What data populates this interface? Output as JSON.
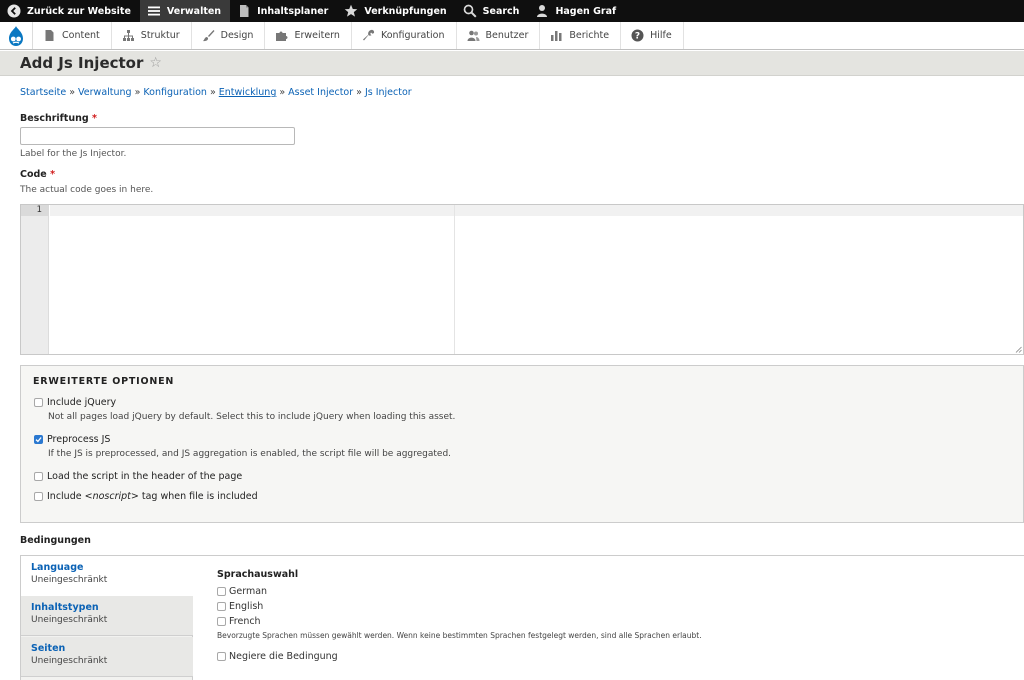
{
  "toolbar": {
    "items": [
      {
        "label": "Zurück zur Website",
        "icon": "arrow-left-circle-icon"
      },
      {
        "label": "Verwalten",
        "icon": "hamburger-menu-icon"
      },
      {
        "label": "Inhaltsplaner",
        "icon": "document-icon"
      },
      {
        "label": "Verknüpfungen",
        "icon": "star-icon"
      },
      {
        "label": "Search",
        "icon": "search-icon"
      },
      {
        "label": "Hagen Graf",
        "icon": "user-icon"
      }
    ]
  },
  "tray": {
    "logo": "drupal-logo-icon",
    "items": [
      {
        "label": "Content",
        "icon": "page-icon"
      },
      {
        "label": "Struktur",
        "icon": "hierarchy-icon"
      },
      {
        "label": "Design",
        "icon": "paintbrush-icon"
      },
      {
        "label": "Erweitern",
        "icon": "puzzle-icon"
      },
      {
        "label": "Konfiguration",
        "icon": "wrench-icon"
      },
      {
        "label": "Benutzer",
        "icon": "people-icon"
      },
      {
        "label": "Berichte",
        "icon": "bar-chart-icon"
      },
      {
        "label": "Hilfe",
        "icon": "help-icon"
      }
    ]
  },
  "page": {
    "title": "Add Js Injector"
  },
  "breadcrumb": [
    "Startseite",
    "Verwaltung",
    "Konfiguration",
    "Entwicklung",
    "Asset Injector",
    "Js Injector"
  ],
  "form": {
    "label_field": {
      "label": "Beschriftung",
      "required_mark": "*",
      "value": "",
      "description": "Label for the Js Injector."
    },
    "code_field": {
      "label": "Code",
      "required_mark": "*",
      "description": "The actual code goes in here.",
      "line_number": "1"
    },
    "advanced": {
      "legend": "ERWEITERTE OPTIONEN",
      "options": [
        {
          "label": "Include jQuery",
          "checked": false,
          "description": "Not all pages load jQuery by default. Select this to include jQuery when loading this asset."
        },
        {
          "label": "Preprocess JS",
          "checked": true,
          "description": "If the JS is preprocessed, and JS aggregation is enabled, the script file will be aggregated."
        },
        {
          "label": "Load the script in the header of the page",
          "checked": false,
          "description": ""
        },
        {
          "label_prefix": "Include ",
          "label_code": "<noscript>",
          "label_suffix": " tag when file is included",
          "checked": false,
          "description": ""
        }
      ]
    },
    "conditions": {
      "heading": "Bedingungen",
      "tabs": [
        {
          "title": "Language",
          "summary": "Uneingeschränkt",
          "active": true
        },
        {
          "title": "Inhaltstypen",
          "summary": "Uneingeschränkt",
          "active": false
        },
        {
          "title": "Seiten",
          "summary": "Uneingeschränkt",
          "active": false
        }
      ],
      "panel": {
        "title": "Sprachauswahl",
        "languages": [
          "German",
          "English",
          "French"
        ],
        "help": "Bevorzugte Sprachen müssen gewählt werden. Wenn keine bestimmten Sprachen festgelegt werden, sind alle Sprachen erlaubt.",
        "negate_label": "Negiere die Bedingung"
      }
    }
  },
  "colors": {
    "link": "#0b62b5",
    "toolbar_bg": "#0f0f0f",
    "checkbox_checked": "#2a78d0",
    "required": "#d01c1c"
  }
}
